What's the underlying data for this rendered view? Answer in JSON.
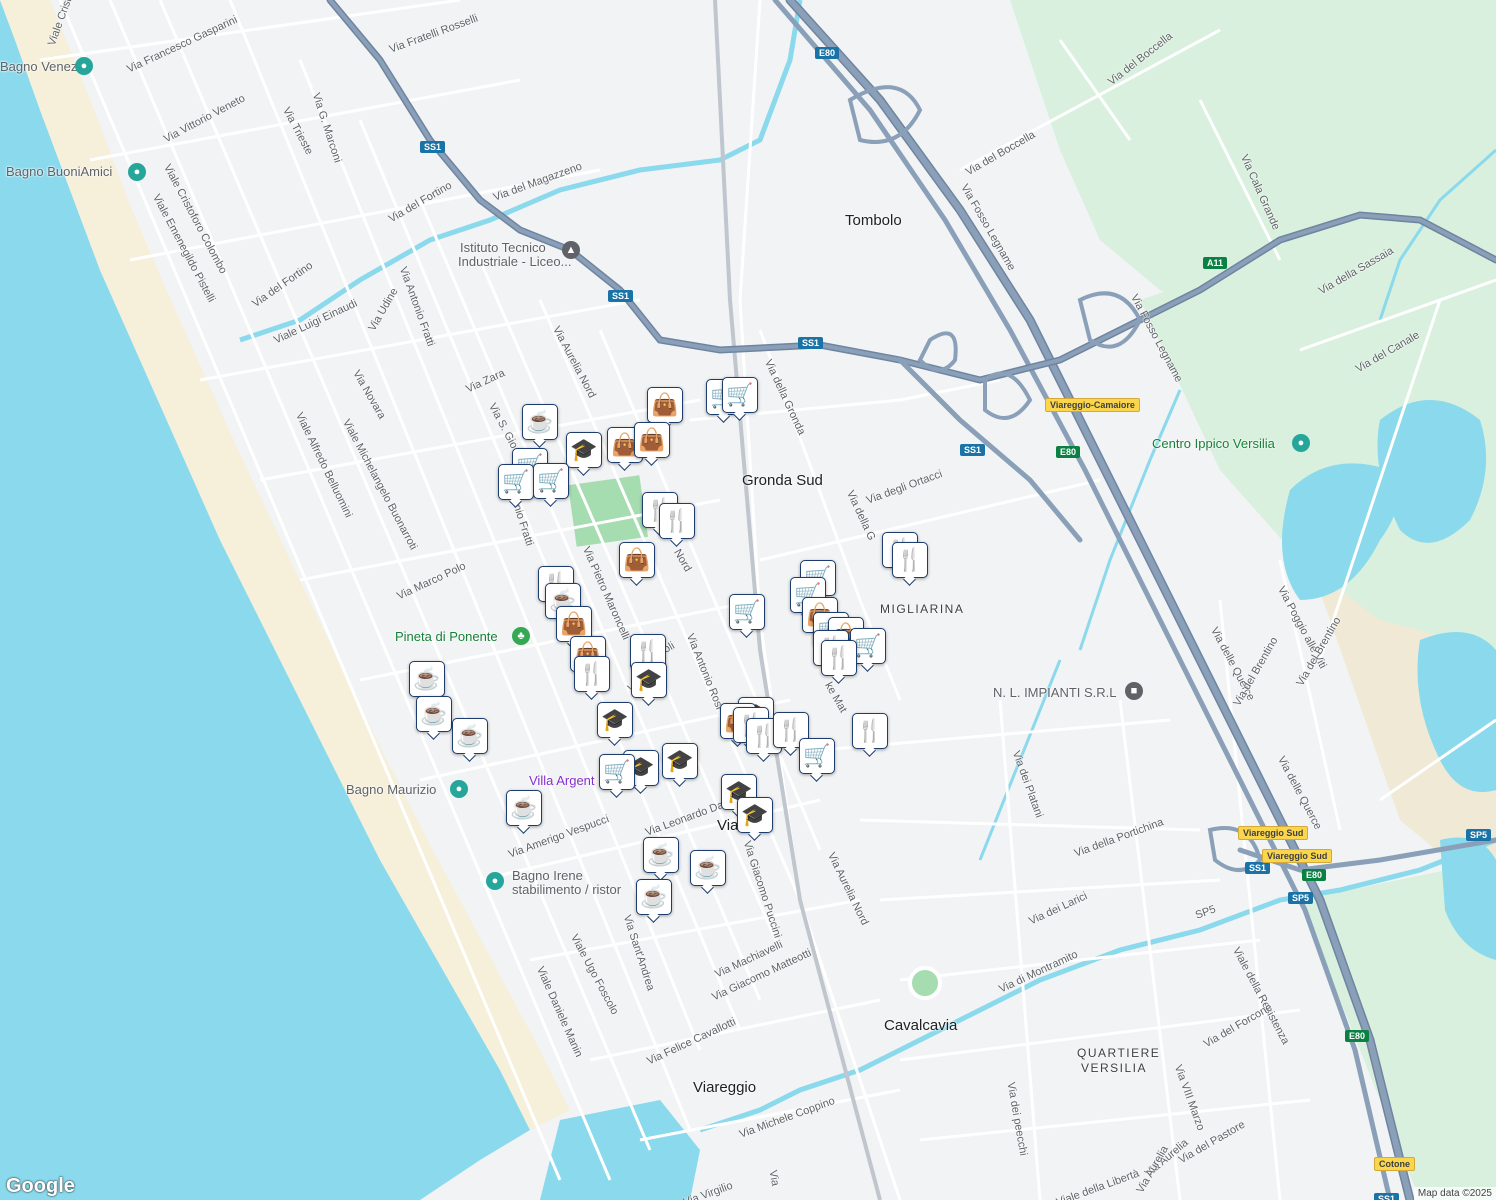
{
  "map": {
    "colors": {
      "land": "#f1f3f4",
      "sea": "#8ad9ec",
      "beach": "#f6efd9",
      "sand_north": "#efe9d6",
      "green_area": "#d8f0dd",
      "park": "#a5dcb0",
      "highway": "#8a9fb8",
      "highway_outline": "#6f84a0",
      "road": "#ffffff",
      "canal": "#8ad9ec",
      "marker_border": "#1c3d6e",
      "marker_icon": "#0e3a63"
    },
    "places": [
      {
        "id": "tombolo",
        "text": "Tombolo"
      },
      {
        "id": "gronda-sud",
        "text": "Gronda Sud"
      },
      {
        "id": "viareggio",
        "text": "Viareggio"
      },
      {
        "id": "cavalcavia",
        "text": "Cavalcavia"
      },
      {
        "id": "via-station",
        "text": "Via"
      }
    ],
    "districts": [
      {
        "id": "migliarina",
        "text": "MIGLIARINA"
      },
      {
        "id": "quartiere-1",
        "text": "QUARTIERE"
      },
      {
        "id": "quartiere-2",
        "text": "VERSILIA"
      }
    ],
    "pois": [
      {
        "id": "bagno-venezia",
        "text": "Bagno Venezia",
        "icon": "pin-icon"
      },
      {
        "id": "bagno-buoniamici",
        "text": "Bagno BuoniAmici",
        "icon": "pin-icon"
      },
      {
        "id": "istituto-1",
        "text": "Istituto Tecnico",
        "icon": "school-icon"
      },
      {
        "id": "istituto-2",
        "text": "Industriale - Liceo...",
        "icon": "school-icon"
      },
      {
        "id": "pineta",
        "text": "Pineta di Ponente",
        "icon": "tree-icon"
      },
      {
        "id": "bagno-maurizio",
        "text": "Bagno Maurizio",
        "icon": "pin-icon"
      },
      {
        "id": "bagno-irene-1",
        "text": "Bagno Irene",
        "icon": "pin-icon"
      },
      {
        "id": "bagno-irene-2",
        "text": "stabilimento / ristor",
        "icon": "pin-icon"
      },
      {
        "id": "villa-argent",
        "text": "Villa Argent",
        "icon": "pin-icon"
      },
      {
        "id": "centro-ippico",
        "text": "Centro Ippico Versilia",
        "icon": "pin-icon"
      },
      {
        "id": "nl-impianti",
        "text": "N. L. IMPIANTI S.R.L",
        "icon": "building-icon"
      }
    ],
    "roads": [
      "Viale Cristoforo Colombo",
      "Via Francesco Gasparini",
      "Via Fratelli Rosselli",
      "Via Vittorio Veneto",
      "Via G. Marconi",
      "Via Trieste",
      "Viale Emenegildo Pistelli",
      "Viale Cristoforo Colombo",
      "Via del Fortino",
      "Via del Fortino",
      "Via del Magazzeno",
      "Viale Luigi Einaudi",
      "Via Udine",
      "Via Antonio Fratti",
      "Via Aurelia Nord",
      "Via Zara",
      "Via Novara",
      "Viale Michelangelo Buonarroti",
      "Viale Alfredo Belluomini",
      "Via S. Gio",
      "Antonio Fratti",
      "Via Marco Polo",
      "Via Pietro Maroncelli",
      "Nord",
      "Via Antonio Rosi",
      "Via Gio",
      "scoli",
      "Via Leonardo Da",
      "Via Amerigo Vespucci",
      "Via Giacomo Puccini",
      "Via Aurelia Nord",
      "Via Sant'Andrea",
      "Viale Ugo Foscolo",
      "Viale Daniele Manin",
      "Via Machiavelli",
      "Via Giacomo Matteotti",
      "Via Felice Cavallotti",
      "Via Michele Coppino",
      "Via Virgilio",
      "Via della Gronda",
      "Via della G",
      "Via degli Ortacci",
      "Via Fosso Legname",
      "Via del Boccella",
      "Via del Boccella",
      "Via Cala Grande",
      "Via della Sassaia",
      "Via Fosso Legname",
      "Via del Canale",
      "Via Poggio alle Viti",
      "Via delle Querce",
      "Via del Brentino",
      "Via delle Querce",
      "Via del Brentino",
      "Via dei Platani",
      "Via della Portichina",
      "Via dei Larici",
      "Via di Montramito",
      "Viale della Resistenza",
      "Via del Forcone",
      "Via VIII Marzo",
      "Via del Pastore",
      "Via dei peecchi",
      "Viale della Libertà",
      "Via Aurelia",
      "ke Mat",
      "Via Aurelia",
      "Via"
    ],
    "shields": [
      {
        "id": "e80-top",
        "text": "E80"
      },
      {
        "id": "ss1-a",
        "text": "SS1"
      },
      {
        "id": "ss1-b",
        "text": "SS1"
      },
      {
        "id": "ss1-c",
        "text": "SS1"
      },
      {
        "id": "ss1-d",
        "text": "SS1"
      },
      {
        "id": "ss1-e",
        "text": "SS1"
      },
      {
        "id": "a11",
        "text": "A11"
      },
      {
        "id": "e80-mid",
        "text": "E80"
      },
      {
        "id": "e80-low",
        "text": "E80"
      },
      {
        "id": "e80-bottom",
        "text": "E80"
      },
      {
        "id": "sp5-right",
        "text": "SP5"
      },
      {
        "id": "sp5-mid",
        "text": "SP5"
      },
      {
        "id": "ss1-bottom",
        "text": "SS1"
      }
    ],
    "exit_labels": [
      {
        "id": "viareggio-camaiore",
        "text": "Viareggio-Camaiore"
      },
      {
        "id": "viareggio-sud-1",
        "text": "Viareggio Sud"
      },
      {
        "id": "viareggio-sud-2",
        "text": "Viareggio Sud"
      },
      {
        "id": "cotone",
        "text": "Cotone"
      }
    ],
    "road_refs": [
      "SP5"
    ],
    "markers": [
      {
        "type": "shop",
        "icon": "shopping-bag-icon"
      },
      {
        "type": "grocery",
        "icon": "shopping-cart-icon"
      },
      {
        "type": "grocery",
        "icon": "shopping-cart-icon"
      },
      {
        "type": "cafe",
        "icon": "coffee-cup-icon"
      },
      {
        "type": "school",
        "icon": "graduation-cap-icon"
      },
      {
        "type": "shop",
        "icon": "shopping-bag-icon"
      },
      {
        "type": "shop",
        "icon": "shopping-bag-icon"
      },
      {
        "type": "grocery",
        "icon": "shopping-cart-icon"
      },
      {
        "type": "grocery",
        "icon": "shopping-cart-icon"
      },
      {
        "type": "grocery",
        "icon": "shopping-cart-icon"
      },
      {
        "type": "restaurant",
        "icon": "fork-knife-icon"
      },
      {
        "type": "restaurant",
        "icon": "fork-knife-icon"
      },
      {
        "type": "shop",
        "icon": "shopping-bag-icon"
      },
      {
        "type": "restaurant",
        "icon": "fork-knife-icon"
      },
      {
        "type": "cafe",
        "icon": "coffee-cup-icon"
      },
      {
        "type": "shop",
        "icon": "shopping-bag-icon"
      },
      {
        "type": "shop",
        "icon": "shopping-bag-icon"
      },
      {
        "type": "restaurant",
        "icon": "fork-knife-icon"
      },
      {
        "type": "restaurant",
        "icon": "fork-knife-icon"
      },
      {
        "type": "school",
        "icon": "graduation-cap-icon"
      },
      {
        "type": "grocery",
        "icon": "shopping-cart-icon"
      },
      {
        "type": "school",
        "icon": "graduation-cap-icon"
      },
      {
        "type": "school",
        "icon": "graduation-cap-icon"
      },
      {
        "type": "school",
        "icon": "graduation-cap-icon"
      },
      {
        "type": "grocery",
        "icon": "shopping-cart-icon"
      },
      {
        "type": "grocery",
        "icon": "shopping-cart-icon"
      },
      {
        "type": "grocery",
        "icon": "shopping-cart-icon"
      },
      {
        "type": "shop",
        "icon": "shopping-bag-icon"
      },
      {
        "type": "grocery",
        "icon": "shopping-cart-icon"
      },
      {
        "type": "shop",
        "icon": "shopping-bag-icon"
      },
      {
        "type": "restaurant",
        "icon": "fork-knife-icon"
      },
      {
        "type": "grocery",
        "icon": "shopping-cart-icon"
      },
      {
        "type": "restaurant",
        "icon": "fork-knife-icon"
      },
      {
        "type": "restaurant",
        "icon": "fork-knife-icon"
      },
      {
        "type": "restaurant",
        "icon": "fork-knife-icon"
      },
      {
        "type": "school",
        "icon": "graduation-cap-icon"
      },
      {
        "type": "shop",
        "icon": "shopping-bag-icon"
      },
      {
        "type": "restaurant",
        "icon": "fork-knife-icon"
      },
      {
        "type": "restaurant",
        "icon": "fork-knife-icon"
      },
      {
        "type": "restaurant",
        "icon": "fork-knife-icon"
      },
      {
        "type": "grocery",
        "icon": "shopping-cart-icon"
      },
      {
        "type": "restaurant",
        "icon": "fork-knife-icon"
      },
      {
        "type": "school",
        "icon": "graduation-cap-icon"
      },
      {
        "type": "school",
        "icon": "graduation-cap-icon"
      },
      {
        "type": "cafe",
        "icon": "coffee-cup-icon"
      },
      {
        "type": "cafe",
        "icon": "coffee-cup-icon"
      },
      {
        "type": "cafe",
        "icon": "coffee-cup-icon"
      },
      {
        "type": "cafe",
        "icon": "coffee-cup-icon"
      },
      {
        "type": "cafe",
        "icon": "coffee-cup-icon"
      },
      {
        "type": "cafe",
        "icon": "coffee-cup-icon"
      },
      {
        "type": "cafe",
        "icon": "coffee-cup-icon"
      }
    ],
    "google_logo": "Google",
    "attribution": "Map data ©2025"
  }
}
